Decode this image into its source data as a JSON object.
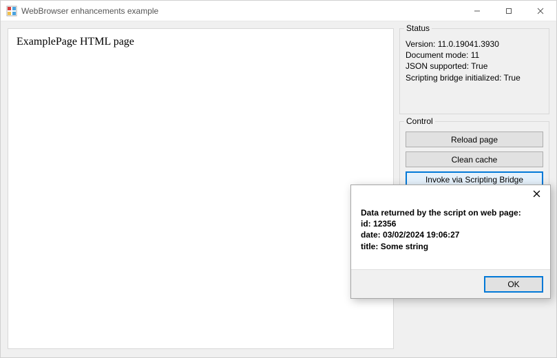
{
  "window": {
    "title": "WebBrowser enhancements example"
  },
  "page": {
    "heading": "ExamplePage HTML page"
  },
  "status": {
    "group_title": "Status",
    "version_label": "Version:",
    "version_value": "11.0.19041.3930",
    "docmode_label": "Document mode:",
    "docmode_value": "11",
    "json_label": "JSON supported:",
    "json_value": "True",
    "bridge_label": "Scripting bridge initialized:",
    "bridge_value": "True"
  },
  "control": {
    "group_title": "Control",
    "reload_label": "Reload page",
    "clean_cache_label": "Clean cache",
    "invoke_label": "Invoke via Scripting Bridge"
  },
  "dialog": {
    "heading": "Data returned by the script on web page:",
    "id_label": "id:",
    "id_value": "12356",
    "date_label": "date:",
    "date_value": "03/02/2024 19:06:27",
    "title_label": "title:",
    "title_value": "Some string",
    "ok_label": "OK"
  }
}
